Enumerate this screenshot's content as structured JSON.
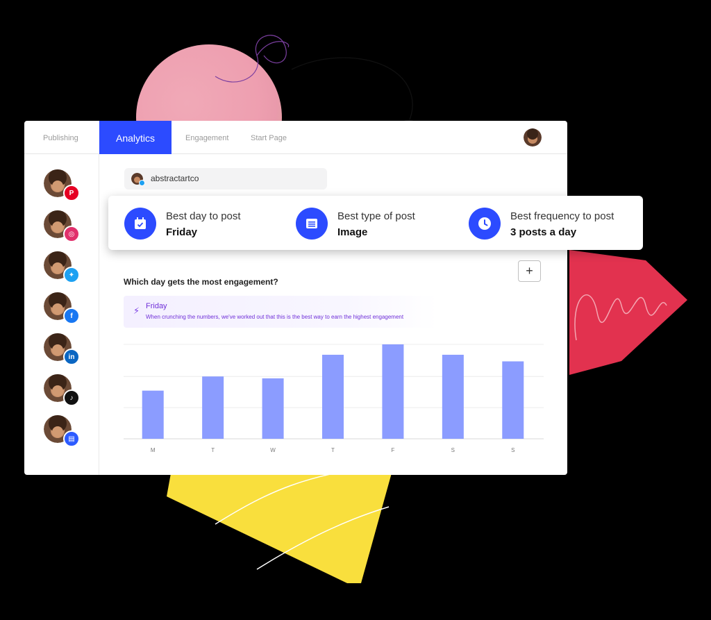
{
  "nav": {
    "tabs": [
      {
        "label": "Publishing",
        "active": false
      },
      {
        "label": "Analytics",
        "active": true
      },
      {
        "label": "Engagement",
        "active": false
      },
      {
        "label": "Start Page",
        "active": false
      }
    ]
  },
  "sidebar": {
    "accounts": [
      {
        "network": "pinterest",
        "icon": "pinterest-icon",
        "color": "#e60023"
      },
      {
        "network": "instagram",
        "icon": "instagram-icon",
        "color": "#e1306c"
      },
      {
        "network": "twitter",
        "icon": "twitter-icon",
        "color": "#1da1f2"
      },
      {
        "network": "facebook",
        "icon": "facebook-icon",
        "color": "#1877f2"
      },
      {
        "network": "linkedin",
        "icon": "linkedin-icon",
        "color": "#0a66c2"
      },
      {
        "network": "tiktok",
        "icon": "tiktok-icon",
        "color": "#111111"
      },
      {
        "network": "shop",
        "icon": "shop-icon",
        "color": "#2c5bff"
      }
    ]
  },
  "profile": {
    "name": "abstractartco",
    "network_icon": "twitter-icon"
  },
  "stats": [
    {
      "label": "Best day to post",
      "value": "Friday",
      "icon": "calendar-icon"
    },
    {
      "label": "Best type of post",
      "value": "Image",
      "icon": "document-icon"
    },
    {
      "label": "Best frequency to post",
      "value": "3 posts a day",
      "icon": "clock-icon"
    }
  ],
  "engagement": {
    "title": "Which day gets the most engagement?",
    "add_label": "+",
    "insight_title": "Friday",
    "insight_text": "When crunching the numbers, we've worked out that this is the best way to earn the highest engagement"
  },
  "colors": {
    "accent": "#2c4bff",
    "bar": "#8b9cff",
    "insight_text": "#6f2fd8"
  },
  "chart_data": {
    "type": "bar",
    "categories": [
      "M",
      "T",
      "W",
      "T",
      "F",
      "S",
      "S"
    ],
    "values": [
      51,
      66,
      64,
      89,
      100,
      89,
      82
    ],
    "ylim": [
      0,
      100
    ],
    "grid": true,
    "title": "",
    "xlabel": "",
    "ylabel": ""
  }
}
